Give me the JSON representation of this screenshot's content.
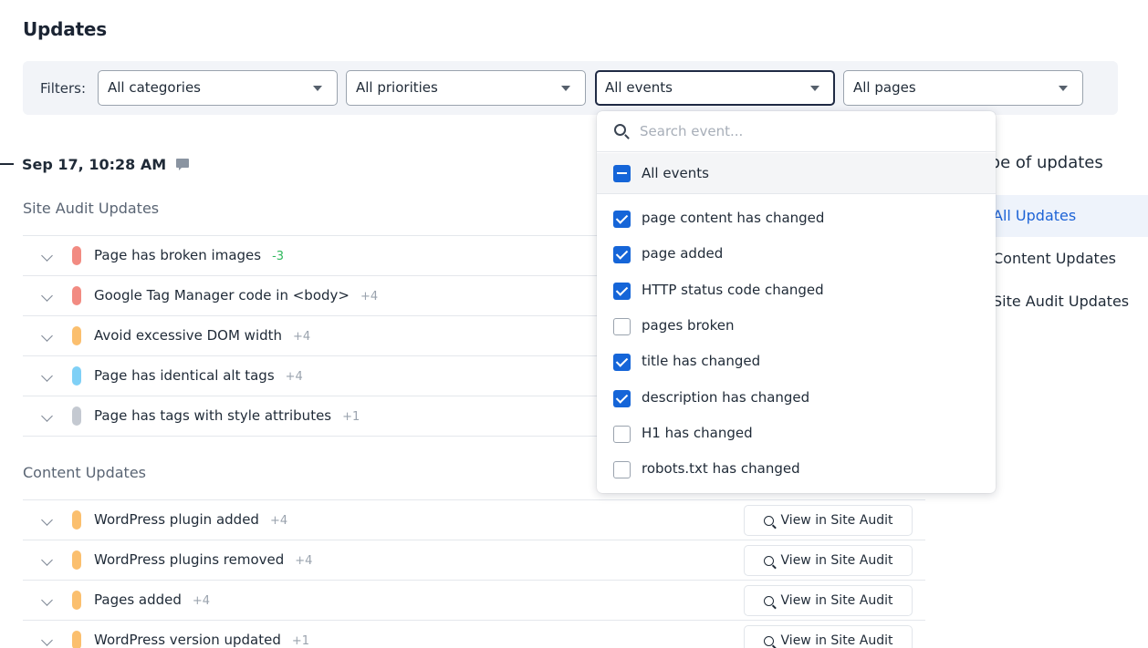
{
  "page": {
    "title": "Updates"
  },
  "filters": {
    "label": "Filters:",
    "selects": [
      {
        "name": "category-select",
        "value": "All categories"
      },
      {
        "name": "priority-select",
        "value": "All priorities"
      },
      {
        "name": "event-select",
        "value": "All events"
      },
      {
        "name": "page-select",
        "value": "All pages"
      }
    ]
  },
  "timeline": {
    "date": "Sep 17, 10:28 AM"
  },
  "site_audit": {
    "title": "Site Audit Updates",
    "rows": [
      {
        "label": "Page has broken images",
        "delta": "-3",
        "color": "#f28b82"
      },
      {
        "label": "Google Tag Manager code in <body>",
        "delta": "+4",
        "color": "#f28b82"
      },
      {
        "label": "Avoid excessive DOM width",
        "delta": "+4",
        "color": "#fbbf6e"
      },
      {
        "label": "Page has identical alt tags",
        "delta": "+4",
        "color": "#7fd0f6"
      },
      {
        "label": "Page has tags with style attributes",
        "delta": "+1",
        "color": "#c4c9d1"
      }
    ]
  },
  "content": {
    "title": "Content Updates",
    "view_label": "View in Site Audit",
    "rows": [
      {
        "label": "WordPress plugin added",
        "delta": "+4",
        "color": "#fbbf6e"
      },
      {
        "label": "WordPress plugins removed",
        "delta": "+4",
        "color": "#fbbf6e"
      },
      {
        "label": "Pages added",
        "delta": "+4",
        "color": "#fbbf6e"
      },
      {
        "label": "WordPress version updated",
        "delta": "+1",
        "color": "#fbbf6e"
      }
    ]
  },
  "right_panel": {
    "title": "ype of updates",
    "items": [
      {
        "label": "All Updates",
        "active": true
      },
      {
        "label": "Content Updates",
        "active": false
      },
      {
        "label": "Site Audit Updates",
        "active": false
      }
    ]
  },
  "event_dropdown": {
    "search_placeholder": "Search event...",
    "all_label": "All events",
    "items": [
      {
        "label": "page content has changed",
        "checked": true
      },
      {
        "label": "page added",
        "checked": true
      },
      {
        "label": "HTTP status code changed",
        "checked": true
      },
      {
        "label": "pages broken",
        "checked": false
      },
      {
        "label": "title has changed",
        "checked": true
      },
      {
        "label": "description has changed",
        "checked": true
      },
      {
        "label": "H1 has changed",
        "checked": false
      },
      {
        "label": "robots.txt has changed",
        "checked": false
      }
    ]
  }
}
